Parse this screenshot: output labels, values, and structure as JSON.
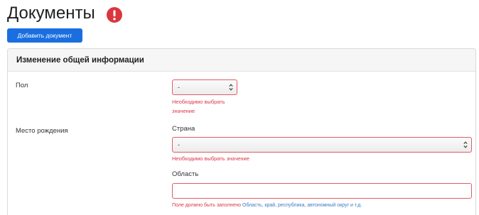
{
  "header": {
    "title": "Документы",
    "add_document_label": "Добавить документ"
  },
  "card": {
    "title": "Изменение общей информации",
    "gender": {
      "label": "Пол",
      "value": "-",
      "error": "Необходимо выбрать значение"
    },
    "birthplace": {
      "label": "Место рождения",
      "country": {
        "label": "Страна",
        "value": "-",
        "error": "Необходимо выбрать значение"
      },
      "region": {
        "label": "Область",
        "value": "",
        "error": "Поле должно быть заполнено",
        "hint": "Область, край, республика, автономный округ и т.д."
      }
    }
  },
  "icons": {
    "alert": "exclamation-circle-icon",
    "select_arrows": "select-arrows-icon"
  },
  "colors": {
    "primary": "#1a6fe0",
    "error": "#dc3545",
    "error_border": "#e25b66",
    "hint": "#3a7cc4",
    "alert": "#d9363e"
  }
}
